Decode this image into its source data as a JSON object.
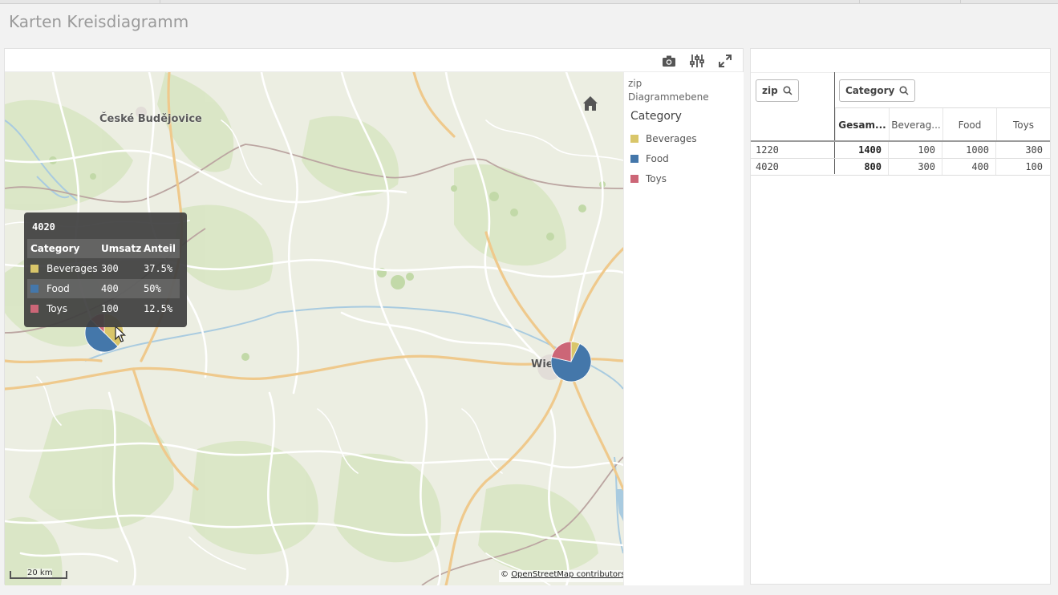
{
  "sheet": {
    "title": "Karten Kreisdiagramm"
  },
  "toolbar": {
    "snapshot_icon": "camera-icon",
    "settings_icon": "sliders-icon",
    "expand_icon": "expand-icon"
  },
  "map": {
    "city_label_budweis": "České Budějovice",
    "city_label_wien": "Wie",
    "home_icon": "home-icon",
    "scale_label": "20 km",
    "attribution_prefix": "©",
    "attribution_link": "OpenStreetMap contributors",
    "pies": [
      {
        "zip": "4020",
        "values": [
          300,
          400,
          100
        ]
      },
      {
        "zip": "1220",
        "values": [
          100,
          1000,
          300
        ]
      }
    ]
  },
  "legend": {
    "dimension": "zip",
    "layer": "Diagrammebene",
    "title": "Category",
    "items": [
      {
        "label": "Beverages",
        "color": "#d9c66a"
      },
      {
        "label": "Food",
        "color": "#4477aa"
      },
      {
        "label": "Toys",
        "color": "#cc6677"
      }
    ]
  },
  "tooltip": {
    "title": "4020",
    "headers": [
      "Category",
      "Umsatz",
      "Anteil"
    ],
    "rows": [
      {
        "category": "Beverages",
        "umsatz": "300",
        "anteil": "37.5%",
        "color": "#d9c66a"
      },
      {
        "category": "Food",
        "umsatz": "400",
        "anteil": "50%",
        "color": "#4477aa"
      },
      {
        "category": "Toys",
        "umsatz": "100",
        "anteil": "12.5%",
        "color": "#cc6677"
      }
    ]
  },
  "table": {
    "filter_zip": "zip",
    "filter_category": "Category",
    "columns": [
      "Gesam...",
      "Beverag...",
      "Food",
      "Toys"
    ],
    "rows": [
      {
        "zip": "1220",
        "total": "1400",
        "beverages": "100",
        "food": "1000",
        "toys": "300"
      },
      {
        "zip": "4020",
        "total": "800",
        "beverages": "300",
        "food": "400",
        "toys": "100"
      }
    ]
  }
}
